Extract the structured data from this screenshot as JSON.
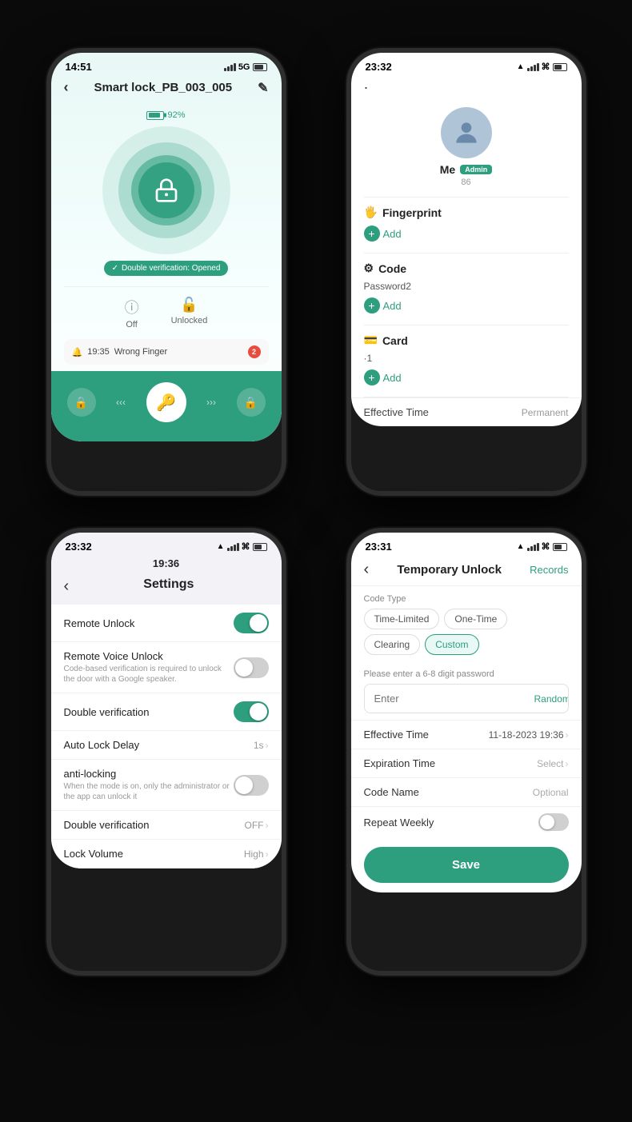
{
  "phone1": {
    "status_time": "14:51",
    "status_network": "5G",
    "title": "Smart lock_PB_003_005",
    "battery_pct": "92%",
    "double_verify": "Double verification: Opened",
    "off_label": "Off",
    "unlocked_label": "Unlocked",
    "alert_time": "19:35",
    "alert_msg": "Wrong Finger",
    "alert_count": "2"
  },
  "phone2": {
    "status_time": "23:32",
    "name": "Me",
    "role": "Admin",
    "count": "86",
    "fingerprint_label": "Fingerprint",
    "fingerprint_add": "Add",
    "code_label": "Code",
    "code_item": "Password2",
    "code_add": "Add",
    "card_label": "Card",
    "card_item": "·1",
    "card_add": "Add",
    "effective_time_label": "Effective Time",
    "effective_time_value": "Permanent"
  },
  "phone3": {
    "status_time": "23:32",
    "inner_time": "19:36",
    "title": "Settings",
    "rows": [
      {
        "label": "Remote Unlock",
        "desc": "",
        "type": "toggle",
        "toggle_on": true,
        "value": ""
      },
      {
        "label": "Remote Voice Unlock",
        "desc": "Code-based verification is required to unlock the door with a Google speaker.",
        "type": "toggle",
        "toggle_on": false,
        "value": ""
      },
      {
        "label": "Double verification",
        "desc": "",
        "type": "toggle",
        "toggle_on": true,
        "value": ""
      },
      {
        "label": "Auto Lock Delay",
        "desc": "",
        "type": "value",
        "toggle_on": false,
        "value": "1s"
      },
      {
        "label": "anti-locking",
        "desc": "When the mode is on, only the administrator or the app can unlock it",
        "type": "toggle",
        "toggle_on": false,
        "value": ""
      },
      {
        "label": "Double verification",
        "desc": "",
        "type": "value",
        "toggle_on": false,
        "value": "OFF"
      },
      {
        "label": "Lock Volume",
        "desc": "",
        "type": "value",
        "toggle_on": false,
        "value": "High"
      }
    ]
  },
  "phone4": {
    "status_time": "23:31",
    "title": "Temporary Unlock",
    "records_label": "Records",
    "code_type_label": "Code Type",
    "code_types": [
      {
        "label": "Time-Limited",
        "active": false
      },
      {
        "label": "One-Time",
        "active": false
      },
      {
        "label": "Clearing",
        "active": false
      },
      {
        "label": "Custom",
        "active": true
      }
    ],
    "password_section_label": "Please enter a 6-8 digit password",
    "password_placeholder": "Enter",
    "random_label": "Random",
    "effective_time_label": "Effective Time",
    "effective_time_value": "11-18-2023 19:36",
    "expiration_time_label": "Expiration Time",
    "expiration_time_value": "Select",
    "code_name_label": "Code Name",
    "code_name_value": "Optional",
    "repeat_weekly_label": "Repeat Weekly",
    "save_label": "Save"
  }
}
